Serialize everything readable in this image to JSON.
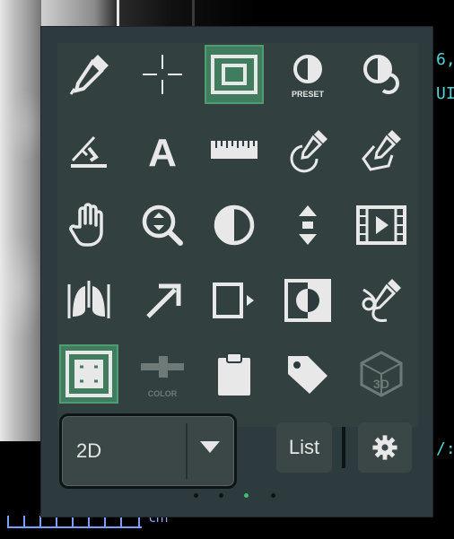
{
  "background": {
    "right_labels": [
      "6,",
      "UI"
    ],
    "far_right_label": "/:",
    "scale_label": "cm"
  },
  "palette": {
    "tools": [
      {
        "name": "eyedropper-icon",
        "active": false
      },
      {
        "name": "crosshair-icon",
        "active": false
      },
      {
        "name": "frame-fit-icon",
        "active": true
      },
      {
        "name": "contrast-preset-icon",
        "active": false,
        "caption": "PRESET"
      },
      {
        "name": "contrast-reset-icon",
        "active": false
      },
      {
        "name": "angle-measure-icon",
        "active": false
      },
      {
        "name": "text-annotation-icon",
        "active": false,
        "glyph": "A"
      },
      {
        "name": "ruler-icon",
        "active": false
      },
      {
        "name": "roi-eyedropper-icon",
        "active": false
      },
      {
        "name": "polygon-eyedropper-icon",
        "active": false
      },
      {
        "name": "hand-pan-icon",
        "active": false
      },
      {
        "name": "zoom-icon",
        "active": false
      },
      {
        "name": "window-level-icon",
        "active": false
      },
      {
        "name": "scroll-stack-icon",
        "active": false
      },
      {
        "name": "cine-film-icon",
        "active": false
      },
      {
        "name": "lungs-icon",
        "active": false
      },
      {
        "name": "arrow-annotation-icon",
        "active": false
      },
      {
        "name": "next-frame-icon",
        "active": false
      },
      {
        "name": "invert-icon",
        "active": false
      },
      {
        "name": "eyedropper-link-icon",
        "active": false
      },
      {
        "name": "fit-window-icon",
        "active": true
      },
      {
        "name": "color-slider-icon",
        "active": false,
        "disabled": true,
        "caption": "COLOR"
      },
      {
        "name": "clipboard-icon",
        "active": false
      },
      {
        "name": "tag-icon",
        "active": false
      },
      {
        "name": "3d-cube-icon",
        "active": false,
        "disabled": true,
        "glyph": "3D"
      }
    ],
    "view_mode": {
      "selected": "2D"
    },
    "list_label": "List",
    "page_indicator": {
      "count": 4,
      "current": 3
    },
    "colors": {
      "panel": "#2d3b3e",
      "active": "#3f7d5e",
      "icon": "#e8e8e8",
      "disabled": "#6d7a78",
      "page_dot_active": "#3fbf6f"
    }
  }
}
